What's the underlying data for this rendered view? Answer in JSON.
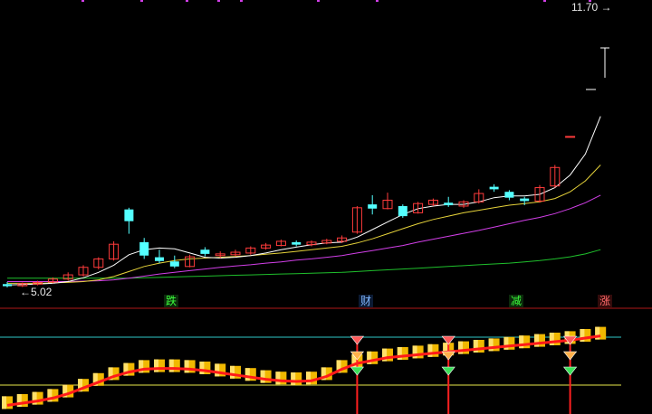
{
  "price_axis": {
    "high_label": "11.70",
    "low_label": "5.02"
  },
  "colors": {
    "background": "#000000",
    "up_candle": "#ff3b3b",
    "down_candle": "#54ffff",
    "ma5": "#ffffff",
    "ma10": "#e5d23a",
    "ma20": "#d23fe8",
    "ma60": "#1fbf2c",
    "signal_line": "#ff1a1a",
    "cyan_level": "#2fc8c8",
    "yellow_level": "#e8e84a"
  },
  "event_tags": [
    {
      "label": "跌",
      "color": "#3cff3c",
      "bg": "#0b2a0b"
    },
    {
      "label": "财",
      "color": "#7fb7ff",
      "bg": "#0b1a33"
    },
    {
      "label": "减",
      "color": "#3cff3c",
      "bg": "#0b2a0b"
    },
    {
      "label": "涨",
      "color": "#ff6a6a",
      "bg": "#330b0b"
    }
  ],
  "chart_data": {
    "type": "candlestick",
    "price_range": [
      5.02,
      11.7
    ],
    "candles": [
      {
        "o": 5.1,
        "c": 5.05,
        "h": 5.15,
        "l": 5.02
      },
      {
        "o": 5.06,
        "c": 5.11,
        "h": 5.14,
        "l": 5.03
      },
      {
        "o": 5.1,
        "c": 5.14,
        "h": 5.18,
        "l": 5.07
      },
      {
        "o": 5.15,
        "c": 5.22,
        "h": 5.26,
        "l": 5.12
      },
      {
        "o": 5.22,
        "c": 5.32,
        "h": 5.38,
        "l": 5.18
      },
      {
        "o": 5.32,
        "c": 5.5,
        "h": 5.55,
        "l": 5.28
      },
      {
        "o": 5.5,
        "c": 5.7,
        "h": 5.74,
        "l": 5.45
      },
      {
        "o": 5.7,
        "c": 6.05,
        "h": 6.12,
        "l": 5.66
      },
      {
        "o": 6.88,
        "c": 6.6,
        "h": 6.92,
        "l": 6.3
      },
      {
        "o": 6.1,
        "c": 5.78,
        "h": 6.2,
        "l": 5.7
      },
      {
        "o": 5.74,
        "c": 5.65,
        "h": 5.92,
        "l": 5.6
      },
      {
        "o": 5.64,
        "c": 5.52,
        "h": 5.78,
        "l": 5.48
      },
      {
        "o": 5.52,
        "c": 5.75,
        "h": 5.8,
        "l": 5.5
      },
      {
        "o": 5.92,
        "c": 5.82,
        "h": 5.98,
        "l": 5.76
      },
      {
        "o": 5.78,
        "c": 5.82,
        "h": 5.88,
        "l": 5.72
      },
      {
        "o": 5.8,
        "c": 5.86,
        "h": 5.92,
        "l": 5.76
      },
      {
        "o": 5.84,
        "c": 5.96,
        "h": 6.0,
        "l": 5.8
      },
      {
        "o": 5.96,
        "c": 6.03,
        "h": 6.08,
        "l": 5.92
      },
      {
        "o": 6.02,
        "c": 6.12,
        "h": 6.16,
        "l": 6.0
      },
      {
        "o": 6.1,
        "c": 6.04,
        "h": 6.14,
        "l": 6.0
      },
      {
        "o": 6.04,
        "c": 6.1,
        "h": 6.14,
        "l": 6.0
      },
      {
        "o": 6.08,
        "c": 6.14,
        "h": 6.18,
        "l": 6.05
      },
      {
        "o": 6.12,
        "c": 6.2,
        "h": 6.26,
        "l": 6.08
      },
      {
        "o": 6.34,
        "c": 6.92,
        "h": 6.96,
        "l": 6.3
      },
      {
        "o": 7.0,
        "c": 6.9,
        "h": 7.22,
        "l": 6.76
      },
      {
        "o": 6.9,
        "c": 7.1,
        "h": 7.28,
        "l": 6.88
      },
      {
        "o": 6.96,
        "c": 6.72,
        "h": 7.0,
        "l": 6.68
      },
      {
        "o": 6.8,
        "c": 7.02,
        "h": 7.06,
        "l": 6.78
      },
      {
        "o": 7.0,
        "c": 7.1,
        "h": 7.14,
        "l": 6.96
      },
      {
        "o": 7.04,
        "c": 6.98,
        "h": 7.18,
        "l": 6.94
      },
      {
        "o": 6.96,
        "c": 7.06,
        "h": 7.1,
        "l": 6.92
      },
      {
        "o": 7.06,
        "c": 7.26,
        "h": 7.36,
        "l": 7.02
      },
      {
        "o": 7.42,
        "c": 7.36,
        "h": 7.48,
        "l": 7.3
      },
      {
        "o": 7.3,
        "c": 7.16,
        "h": 7.34,
        "l": 7.1
      },
      {
        "o": 7.14,
        "c": 7.08,
        "h": 7.18,
        "l": 6.98
      },
      {
        "o": 7.08,
        "c": 7.4,
        "h": 7.46,
        "l": 7.04
      },
      {
        "o": 7.44,
        "c": 7.88,
        "h": 7.94,
        "l": 7.4
      },
      {
        "o": 8.62,
        "c": 8.62,
        "h": 8.62,
        "l": 8.62
      }
    ],
    "ma5": [
      5.08,
      5.09,
      5.1,
      5.12,
      5.16,
      5.25,
      5.38,
      5.55,
      5.8,
      5.92,
      5.96,
      5.94,
      5.84,
      5.74,
      5.72,
      5.74,
      5.78,
      5.84,
      5.92,
      5.98,
      6.04,
      6.08,
      6.1,
      6.22,
      6.4,
      6.58,
      6.76,
      6.9,
      6.96,
      7.0,
      7.0,
      7.06,
      7.16,
      7.2,
      7.2,
      7.24,
      7.4,
      7.7,
      8.2,
      9.1
    ],
    "ma10": [
      5.12,
      5.12,
      5.12,
      5.13,
      5.14,
      5.16,
      5.2,
      5.28,
      5.4,
      5.52,
      5.6,
      5.66,
      5.7,
      5.72,
      5.74,
      5.76,
      5.78,
      5.81,
      5.84,
      5.88,
      5.92,
      5.96,
      6.0,
      6.08,
      6.18,
      6.3,
      6.42,
      6.54,
      6.64,
      6.72,
      6.8,
      6.86,
      6.92,
      6.98,
      7.02,
      7.06,
      7.14,
      7.3,
      7.56,
      7.94
    ],
    "ma20": [
      5.16,
      5.16,
      5.16,
      5.16,
      5.16,
      5.17,
      5.18,
      5.2,
      5.24,
      5.29,
      5.34,
      5.38,
      5.42,
      5.46,
      5.5,
      5.53,
      5.56,
      5.6,
      5.63,
      5.67,
      5.7,
      5.74,
      5.78,
      5.84,
      5.9,
      5.96,
      6.02,
      6.1,
      6.17,
      6.24,
      6.31,
      6.38,
      6.46,
      6.54,
      6.62,
      6.69,
      6.78,
      6.9,
      7.04,
      7.22
    ],
    "ma60": [
      5.24,
      5.24,
      5.24,
      5.24,
      5.24,
      5.24,
      5.24,
      5.24,
      5.24,
      5.25,
      5.26,
      5.27,
      5.28,
      5.29,
      5.3,
      5.31,
      5.32,
      5.33,
      5.34,
      5.35,
      5.36,
      5.37,
      5.38,
      5.4,
      5.42,
      5.44,
      5.46,
      5.48,
      5.5,
      5.52,
      5.54,
      5.56,
      5.58,
      5.6,
      5.63,
      5.66,
      5.7,
      5.75,
      5.82,
      5.92
    ],
    "signal": [
      0.02,
      0.05,
      0.08,
      0.12,
      0.18,
      0.26,
      0.34,
      0.42,
      0.48,
      0.52,
      0.53,
      0.53,
      0.52,
      0.5,
      0.47,
      0.44,
      0.41,
      0.38,
      0.36,
      0.35,
      0.36,
      0.42,
      0.52,
      0.6,
      0.64,
      0.68,
      0.7,
      0.72,
      0.74,
      0.76,
      0.78,
      0.8,
      0.82,
      0.84,
      0.86,
      0.88,
      0.9,
      0.92,
      0.95,
      0.98
    ],
    "alerts": [
      23,
      29,
      37
    ]
  }
}
